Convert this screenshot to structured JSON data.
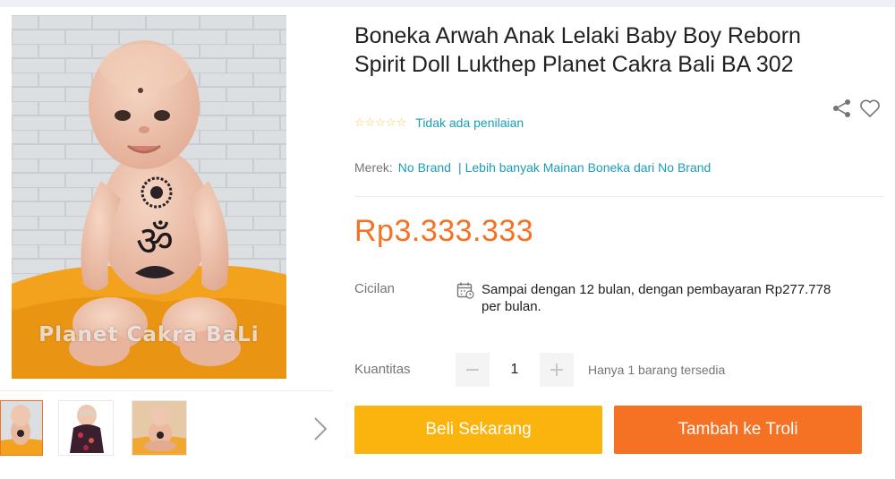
{
  "product": {
    "title": "Boneka Arwah Anak Lelaki Baby Boy Reborn Spirit Doll Lukthep Planet Cakra Bali BA 302",
    "rating": {
      "stars": 0,
      "max_stars": 5,
      "text": "Tidak ada penilaian"
    },
    "brand": {
      "label": "Merek:",
      "value": "No Brand",
      "more_link": "Lebih banyak Mainan Boneka dari No Brand"
    },
    "price": "Rp3.333.333",
    "installment": {
      "label": "Cicilan",
      "text": "Sampai dengan 12 bulan, dengan pembayaran Rp277.778 per bulan."
    },
    "quantity": {
      "label": "Kuantitas",
      "value": "1",
      "minus": "−",
      "plus": "+",
      "stock_note": "Hanya 1 barang tersedia"
    }
  },
  "gallery": {
    "watermark": "Planet Cakra BaLi",
    "thumbnails": [
      "doll-front",
      "doll-in-dress",
      "doll-sitting"
    ],
    "active_thumbnail": 0
  },
  "actions": {
    "buy_now": "Beli Sekarang",
    "add_to_cart": "Tambah ke Troli"
  },
  "icons": {
    "share": "share-icon",
    "wishlist": "heart-icon",
    "calendar": "calendar-icon",
    "next": "chevron-right-icon"
  },
  "colors": {
    "price_orange": "#f57224",
    "buy_yellow": "#fbb40e",
    "link_blue": "#1a9cb7",
    "star_yellow": "#faca51"
  }
}
